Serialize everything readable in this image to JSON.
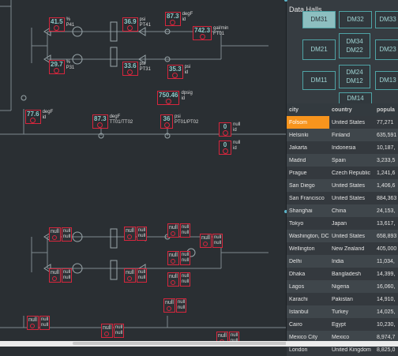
{
  "tags": [
    {
      "id": "p41",
      "value": "41.5",
      "label": "%\nP41"
    },
    {
      "id": "pt41",
      "value": "36.9",
      "label": "psi\nPT41"
    },
    {
      "id": "degf1",
      "value": "87.3",
      "label": "degF\nid"
    },
    {
      "id": "ft01",
      "value": "742.3",
      "label": "gal/min\nFT01"
    },
    {
      "id": "p31",
      "value": "29.7",
      "label": "%\nP31"
    },
    {
      "id": "pt31",
      "value": "33.6",
      "label": "psi\nPT31"
    },
    {
      "id": "psi35",
      "value": "35.3",
      "label": "psi\nid"
    },
    {
      "id": "dpsig",
      "value": "750.46",
      "label": "dpsig\nid"
    },
    {
      "id": "degf2",
      "value": "77.6",
      "label": "degF\nid"
    },
    {
      "id": "tt01",
      "value": "87.3",
      "label": "degF\nTT01/TT02"
    },
    {
      "id": "pt01",
      "value": "36",
      "label": "psi\nPT01/PT02"
    },
    {
      "id": "null1",
      "value": "0",
      "label": "null\nid"
    },
    {
      "id": "null2",
      "value": "0",
      "label": "null\nid"
    }
  ],
  "null_text": "null",
  "panel": {
    "title": "Data Halls",
    "halls": [
      "DM31",
      "DM32",
      "DM33",
      "DM21",
      "DM34\nDM22",
      "DM23",
      "DM11",
      "DM24\nDM12",
      "DM13",
      "DM14"
    ],
    "columns": [
      "city",
      "country",
      "popula"
    ],
    "rows": [
      [
        "Folsom",
        "United States",
        "77,271"
      ],
      [
        "Helsinki",
        "Finland",
        "635,591"
      ],
      [
        "Jakarta",
        "Indonesia",
        "10,187,"
      ],
      [
        "Madrid",
        "Spain",
        "3,233,5"
      ],
      [
        "Prague",
        "Czech Republic",
        "1,241,6"
      ],
      [
        "San Diego",
        "United States",
        "1,406,6"
      ],
      [
        "San Francisco",
        "United States",
        "884,363"
      ],
      [
        "Shanghai",
        "China",
        "24,153,"
      ],
      [
        "Tokyo",
        "Japan",
        "13,617,"
      ],
      [
        "Washington, DC",
        "United States",
        "658,893"
      ],
      [
        "Wellington",
        "New Zealand",
        "405,000"
      ],
      [
        "Delhi",
        "India",
        "11,034,"
      ],
      [
        "Dhaka",
        "Bangladesh",
        "14,399,"
      ],
      [
        "Lagos",
        "Nigeria",
        "16,060,"
      ],
      [
        "Karachi",
        "Pakistan",
        "14,910,"
      ],
      [
        "Istanbul",
        "Turkey",
        "14,025,"
      ],
      [
        "Cairo",
        "Egypt",
        "10,230,"
      ],
      [
        "Mexico City",
        "Mexico",
        "8,974,7"
      ],
      [
        "London",
        "United Kingdom",
        "8,825,0"
      ]
    ]
  }
}
